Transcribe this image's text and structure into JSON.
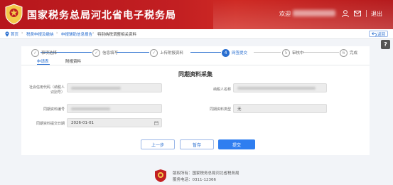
{
  "header": {
    "site_title": "国家税务总局河北省电子税务局",
    "welcome": "欢迎",
    "logout": "退出"
  },
  "breadcrumb": {
    "items": [
      "首页",
      "税费申报及缴纳",
      "申报辅助信息报告",
      "特别纳税调整相关资料"
    ],
    "back_label": "返回"
  },
  "steps": [
    {
      "num": "✓",
      "label": "事项选择"
    },
    {
      "num": "✓",
      "label": "信息填写"
    },
    {
      "num": "✓",
      "label": "上传附报资料"
    },
    {
      "num": "4",
      "label": "网签提交"
    },
    {
      "num": "5",
      "label": "审核中"
    },
    {
      "num": "6",
      "label": "完成"
    }
  ],
  "tabs": {
    "apply": "申请表",
    "attachments": "附报资料"
  },
  "form": {
    "title": "同期资料采集",
    "tax_id_label": "社会信用代码（纳税人识别号）",
    "taxpayer_name_label": "纳税人名称",
    "doc_number_label": "同期资料编号",
    "doc_type_label": "同期资料类型",
    "doc_type_value": "无",
    "date_label": "同期资料提交日期",
    "date_value": "2026-01-01"
  },
  "buttons": {
    "prev": "上一步",
    "save": "暂存",
    "submit": "提交"
  },
  "footer": {
    "copyright": "版权所有：国家税务总局河北省税务局",
    "hotline": "服务电话：0311-12366"
  },
  "colors": {
    "brand_red": "#c21f22",
    "accent_blue": "#2a6fd0",
    "button_blue": "#2f7ef0"
  }
}
